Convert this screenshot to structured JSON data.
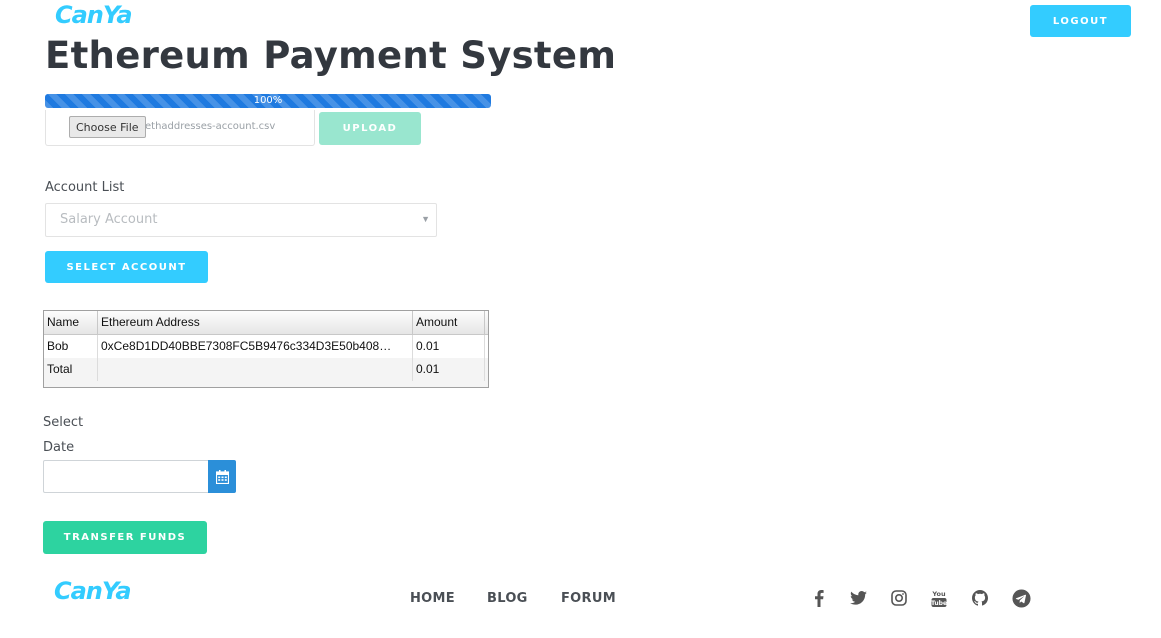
{
  "header": {
    "logo_text": "CanYa",
    "logout_label": "LOGOUT",
    "title": "Ethereum Payment System"
  },
  "upload": {
    "progress_percent": 100,
    "progress_label": "100%",
    "choose_file_label": "Choose File",
    "file_name": "ethaddresses-account.csv",
    "upload_label": "UPLOAD"
  },
  "account": {
    "label": "Account List",
    "selected": "Salary Account",
    "select_button": "SELECT ACCOUNT"
  },
  "grid": {
    "columns": [
      "Name",
      "Ethereum Address",
      "Amount"
    ],
    "rows": [
      [
        "Bob",
        "0xCe8D1DD40BBE7308FC5B9476c334D3E50b408…",
        "0.01"
      ],
      [
        "Total",
        "",
        "0.01"
      ]
    ]
  },
  "date": {
    "label_line1": "Select",
    "label_line2": "Date",
    "value": "",
    "calendar_icon": "calendar-icon"
  },
  "transfer_button": "TRANSFER FUNDS",
  "footer": {
    "logo_text": "CanYa",
    "nav": [
      "HOME",
      "BLOG",
      "FORUM"
    ],
    "social_icons": [
      "facebook-icon",
      "twitter-icon",
      "instagram-icon",
      "youtube-icon",
      "github-icon",
      "telegram-icon"
    ]
  },
  "colors": {
    "accent": "#33ccff",
    "success": "#2dd3a0",
    "upload_disabled": "#99e6cf",
    "progress": "#1f7ae0",
    "calendar_button": "#2b8fd9"
  }
}
